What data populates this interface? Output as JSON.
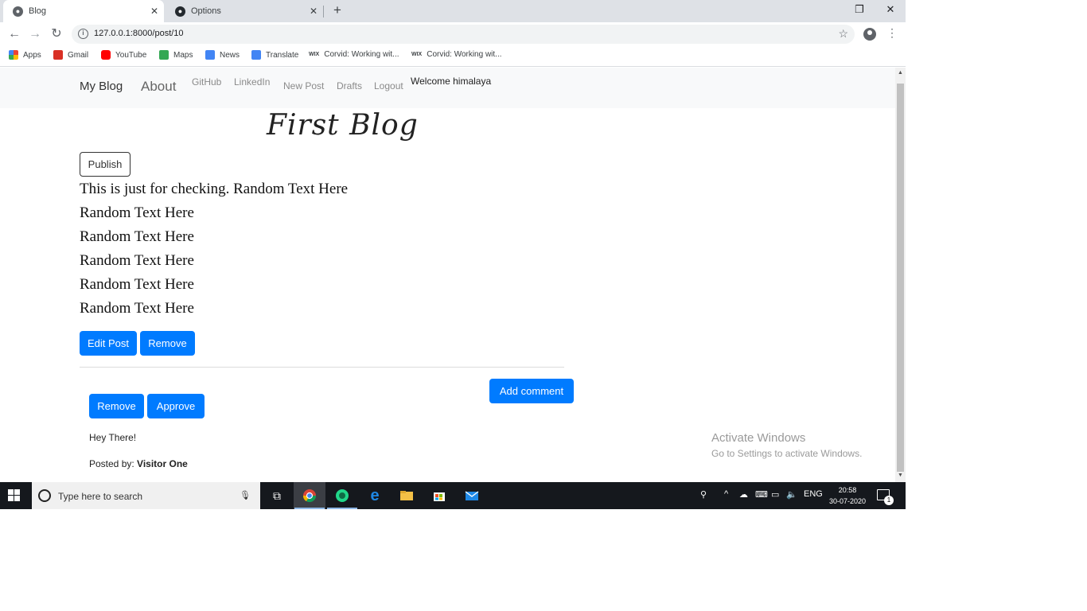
{
  "browser": {
    "tabs": [
      {
        "title": "Blog"
      },
      {
        "title": "Options"
      }
    ],
    "tab_close": "✕",
    "new_tab": "+",
    "url": "127.0.0.1:8000/post/10",
    "bookmarks": [
      {
        "label": "Apps",
        "color": "#e8453c"
      },
      {
        "label": "Gmail",
        "color": "#d93025"
      },
      {
        "label": "YouTube",
        "color": "#ff0000"
      },
      {
        "label": "Maps",
        "color": "#34a853"
      },
      {
        "label": "News",
        "color": "#4285f4"
      },
      {
        "label": "Translate",
        "color": "#4285f4"
      },
      {
        "label": "Corvid: Working wit...",
        "color": "#333333",
        "badge": "WIX"
      },
      {
        "label": "Corvid: Working wit...",
        "color": "#333333",
        "badge": "WIX"
      }
    ]
  },
  "site": {
    "brand": "My Blog",
    "nav": {
      "about": "About",
      "github": "GitHub",
      "linkedin": "LinkedIn",
      "new_post": "New Post",
      "drafts": "Drafts",
      "logout": "Logout",
      "welcome": "Welcome himalaya"
    }
  },
  "post": {
    "title": "First Blog",
    "publish_label": "Publish",
    "lines": [
      "This is just for checking. Random Text Here",
      "Random Text Here",
      "Random Text Here",
      "Random Text Here",
      "Random Text Here",
      "Random Text Here"
    ],
    "edit_label": "Edit Post",
    "remove_label": "Remove"
  },
  "comments": {
    "add_label": "Add comment",
    "items": [
      {
        "remove_label": "Remove",
        "approve_label": "Approve",
        "text": "Hey There!",
        "posted_by_prefix": "Posted by:",
        "author": "Visitor One"
      }
    ]
  },
  "watermark": {
    "title": "Activate Windows",
    "subtitle": "Go to Settings to activate Windows."
  },
  "taskbar": {
    "search_placeholder": "Type here to search",
    "tray": {
      "language": "ENG",
      "time": "20:58",
      "date": "30-07-2020",
      "notification_count": "1"
    }
  },
  "colors": {
    "primary": "#007bff",
    "nav_bg": "#f8f9fa",
    "taskbar_bg": "#15181d"
  }
}
